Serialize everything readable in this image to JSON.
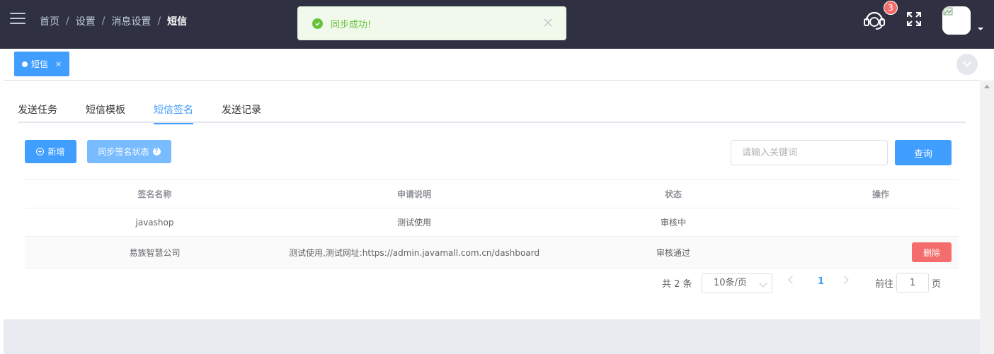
{
  "header": {
    "breadcrumb": [
      {
        "label": "首页"
      },
      {
        "label": "设置"
      },
      {
        "label": "消息设置"
      },
      {
        "label": "短信"
      }
    ],
    "separator": "/",
    "notification_count": "3",
    "colors": {
      "bar": "#2f3142",
      "badge": "#f56c6c"
    }
  },
  "toast": {
    "message": "同步成功!",
    "color": "#67c23a"
  },
  "tags": {
    "active_tag": "短信",
    "close_glyph": "×"
  },
  "tabs": [
    {
      "label": "发送任务",
      "active": false
    },
    {
      "label": "短信模板",
      "active": false
    },
    {
      "label": "短信签名",
      "active": true
    },
    {
      "label": "发送记录",
      "active": false
    }
  ],
  "toolbar": {
    "add_label": "新增",
    "sync_label": "同步签名状态",
    "help_glyph": "?",
    "search_placeholder": "请输入关键词",
    "search_label": "查询"
  },
  "table": {
    "columns": [
      "签名名称",
      "申请说明",
      "状态",
      "操作"
    ],
    "rows": [
      {
        "name": "javashop",
        "description": "测试使用",
        "status": "审核中",
        "action": ""
      },
      {
        "name": "易族智慧公司",
        "description": "测试使用,测试网址:https://admin.javamall.com.cn/dashboard",
        "status": "审核通过",
        "action": "删除"
      }
    ]
  },
  "pagination": {
    "total_text": "共 2 条",
    "page_size": "10条/页",
    "current_page": "1",
    "goto_prefix": "前往",
    "goto_value": "1",
    "goto_suffix": "页"
  },
  "icons": {
    "menu": "hamburger-icon",
    "support": "headset-icon",
    "fullscreen": "fullscreen-icon",
    "toast": "check-circle-icon"
  },
  "accent_color": "#409eff"
}
